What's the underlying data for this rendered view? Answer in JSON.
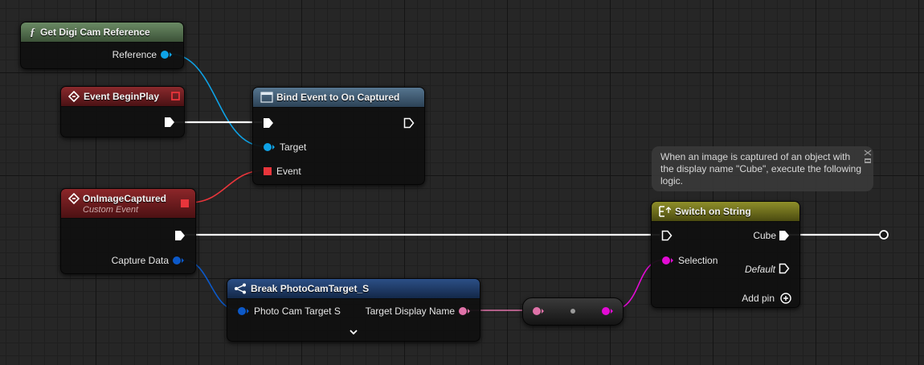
{
  "graph": {
    "nodes": {
      "get_digi_cam": {
        "title": "Get Digi Cam Reference",
        "title_icon": "function-icon",
        "header_color": "#556d51",
        "pins": {
          "reference": "Reference"
        }
      },
      "event_begin_play": {
        "title": "Event BeginPlay",
        "title_icon": "event-icon",
        "header_color": "#6e1f22"
      },
      "bind_event": {
        "title": "Bind Event to On Captured",
        "title_icon": "delegate-node-icon",
        "header_color": "#3c5a72",
        "pins": {
          "target": "Target",
          "event": "Event"
        }
      },
      "on_image_captured": {
        "title": "OnImageCaptured",
        "subtitle": "Custom Event",
        "title_icon": "event-icon",
        "header_color": "#7a2022",
        "pins": {
          "capture_data": "Capture Data"
        }
      },
      "break_struct": {
        "title": "Break PhotoCamTarget_S",
        "title_icon": "break-struct-icon",
        "header_color": "#1f3d6b",
        "pins": {
          "photo_cam_target": "Photo Cam Target S",
          "target_display_name": "Target Display Name"
        }
      },
      "switch_on_string": {
        "title": "Switch on String",
        "title_icon": "switch-icon",
        "header_color": "#7d7d1e",
        "pins": {
          "selection": "Selection",
          "cube": "Cube",
          "default": "Default",
          "add_pin": "Add pin"
        }
      }
    },
    "comment": {
      "text": "When an image is captured of an object with the display name \"Cube\", execute the following logic."
    },
    "pin_colors": {
      "exec": "#ffffff",
      "object": "#0ea2e6",
      "struct": "#0c59c9",
      "delegate": "#e8353b",
      "string": "#df72a8",
      "name": "#e30bd5"
    }
  }
}
